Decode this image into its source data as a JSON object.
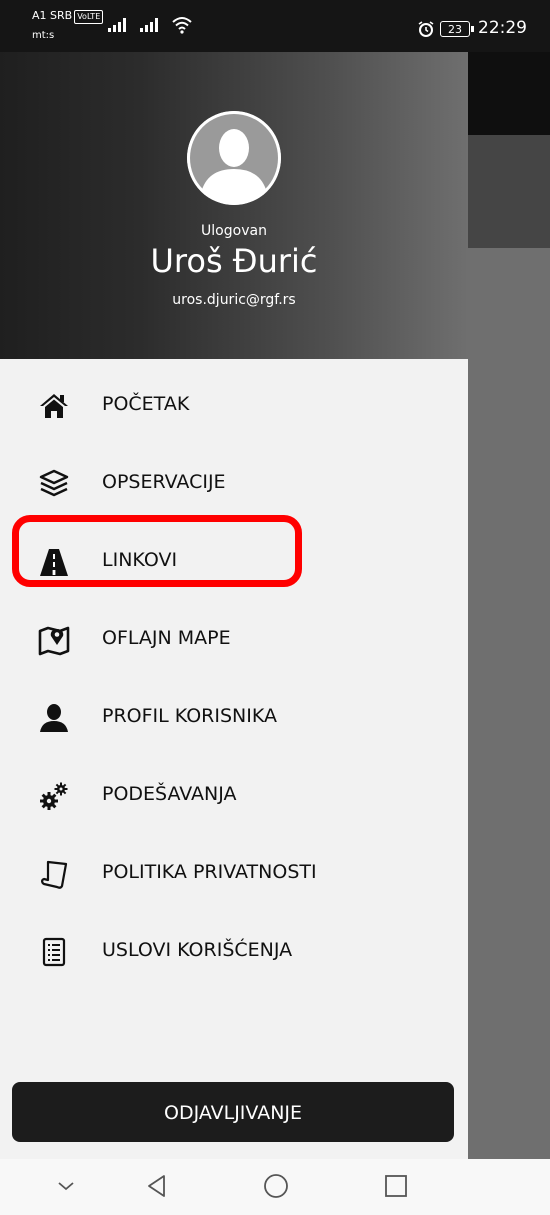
{
  "status_bar": {
    "carrier": "A1 SRB",
    "volte": "VoLTE",
    "carrier2": "mt:s",
    "battery": "23",
    "time": "22:29"
  },
  "drawer": {
    "status_label": "Ulogovan",
    "user_name": "Uroš Đurić",
    "user_email": "uros.djuric@rgf.rs",
    "items": [
      {
        "label": "POČETAK",
        "icon": "home-icon"
      },
      {
        "label": "OPSERVACIJE",
        "icon": "layers-icon"
      },
      {
        "label": "LINKOVI",
        "icon": "road-icon"
      },
      {
        "label": "OFLAJN MAPE",
        "icon": "map-pin-icon"
      },
      {
        "label": "PROFIL KORISNIKA",
        "icon": "user-icon"
      },
      {
        "label": "PODEŠAVANJA",
        "icon": "gears-icon"
      },
      {
        "label": "POLITIKA PRIVATNOSTI",
        "icon": "document-icon"
      },
      {
        "label": "USLOVI KORIŠĆENJA",
        "icon": "list-icon"
      }
    ],
    "logout_label": "ODJAVLJIVANJE"
  },
  "colors": {
    "highlight": "#ff0000",
    "logout_bg": "#1c1c1c"
  }
}
